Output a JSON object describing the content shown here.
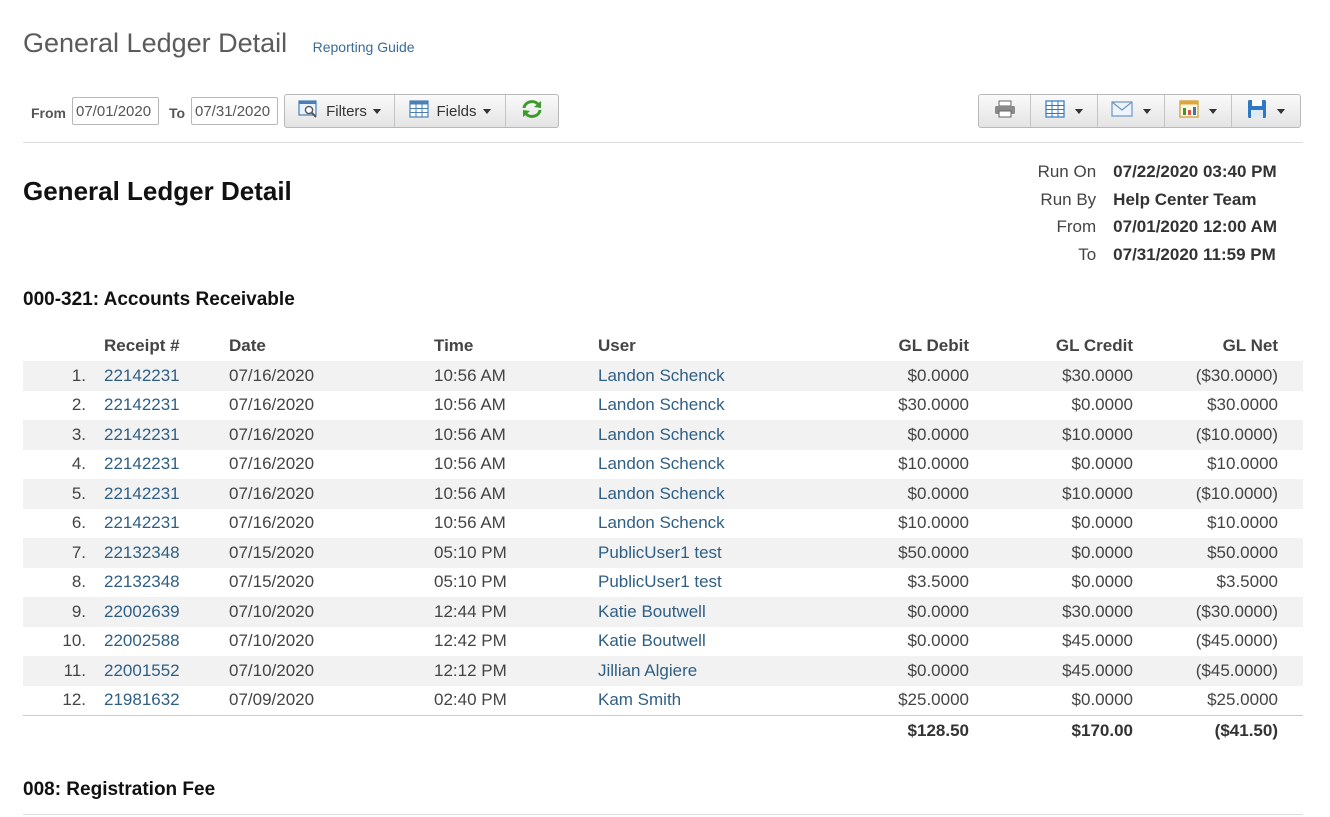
{
  "header": {
    "title": "General Ledger Detail",
    "guide_link": "Reporting Guide"
  },
  "toolbar": {
    "from_label": "From",
    "from_value": "07/01/2020",
    "to_label": "To",
    "to_value": "07/31/2020",
    "filters_label": "Filters",
    "fields_label": "Fields"
  },
  "report": {
    "title": "General Ledger Detail",
    "meta": [
      {
        "key": "Run On",
        "value": "07/22/2020 03:40 PM"
      },
      {
        "key": "Run By",
        "value": "Help Center Team"
      },
      {
        "key": "From",
        "value": "07/01/2020 12:00 AM"
      },
      {
        "key": "To",
        "value": "07/31/2020 11:59 PM"
      }
    ]
  },
  "sections": [
    {
      "title": "000-321: Accounts Receivable"
    },
    {
      "title": "008: Registration Fee"
    }
  ],
  "table": {
    "headers": [
      "Receipt #",
      "Date",
      "Time",
      "User",
      "GL Debit",
      "GL Credit",
      "GL Net"
    ],
    "rows": [
      [
        "1.",
        "22142231",
        "07/16/2020",
        "10:56 AM",
        "Landon Schenck",
        "$0.0000",
        "$30.0000",
        "($30.0000)"
      ],
      [
        "2.",
        "22142231",
        "07/16/2020",
        "10:56 AM",
        "Landon Schenck",
        "$30.0000",
        "$0.0000",
        "$30.0000"
      ],
      [
        "3.",
        "22142231",
        "07/16/2020",
        "10:56 AM",
        "Landon Schenck",
        "$0.0000",
        "$10.0000",
        "($10.0000)"
      ],
      [
        "4.",
        "22142231",
        "07/16/2020",
        "10:56 AM",
        "Landon Schenck",
        "$10.0000",
        "$0.0000",
        "$10.0000"
      ],
      [
        "5.",
        "22142231",
        "07/16/2020",
        "10:56 AM",
        "Landon Schenck",
        "$0.0000",
        "$10.0000",
        "($10.0000)"
      ],
      [
        "6.",
        "22142231",
        "07/16/2020",
        "10:56 AM",
        "Landon Schenck",
        "$10.0000",
        "$0.0000",
        "$10.0000"
      ],
      [
        "7.",
        "22132348",
        "07/15/2020",
        "05:10 PM",
        "PublicUser1 test",
        "$50.0000",
        "$0.0000",
        "$50.0000"
      ],
      [
        "8.",
        "22132348",
        "07/15/2020",
        "05:10 PM",
        "PublicUser1 test",
        "$3.5000",
        "$0.0000",
        "$3.5000"
      ],
      [
        "9.",
        "22002639",
        "07/10/2020",
        "12:44 PM",
        "Katie Boutwell",
        "$0.0000",
        "$30.0000",
        "($30.0000)"
      ],
      [
        "10.",
        "22002588",
        "07/10/2020",
        "12:42 PM",
        "Katie Boutwell",
        "$0.0000",
        "$45.0000",
        "($45.0000)"
      ],
      [
        "11.",
        "22001552",
        "07/10/2020",
        "12:12 PM",
        "Jillian Algiere",
        "$0.0000",
        "$45.0000",
        "($45.0000)"
      ],
      [
        "12.",
        "21981632",
        "07/09/2020",
        "02:40 PM",
        "Kam Smith",
        "$25.0000",
        "$0.0000",
        "$25.0000"
      ]
    ],
    "totals": {
      "debit": "$128.50",
      "credit": "$170.00",
      "net": "($41.50)"
    }
  },
  "icons": {
    "filters": "filter-icon",
    "fields": "columns-icon",
    "refresh": "refresh-icon",
    "print": "print-icon",
    "table": "table-icon",
    "email": "email-icon",
    "chart": "chart-icon",
    "save": "save-icon"
  },
  "colors": {
    "link": "#2f5f85",
    "refresh_green": "#3a9a2a",
    "export_blue": "#2f78c4"
  }
}
